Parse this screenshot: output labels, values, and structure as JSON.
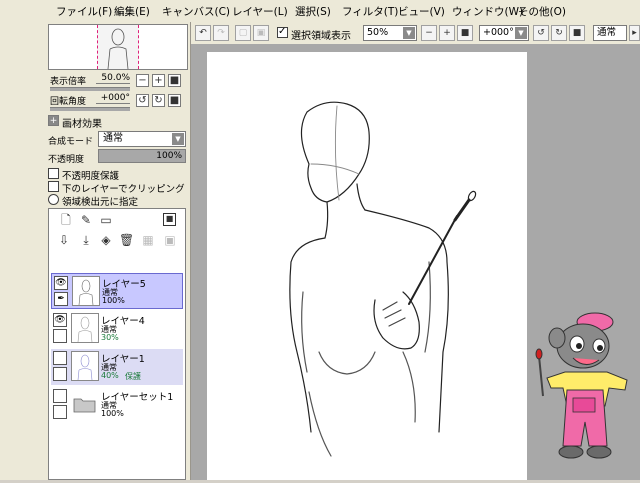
{
  "menu": [
    "ファイル(F)",
    "編集(E)",
    "キャンバス(C)",
    "レイヤー(L)",
    "選択(S)",
    "フィルタ(T)",
    "ビュー(V)",
    "ウィンドウ(W)",
    "その他(O)"
  ],
  "navigator": {
    "zoom_label": "表示倍率",
    "zoom_value": "50.0%",
    "rotate_label": "回転角度",
    "rotate_value": "+000°"
  },
  "paper_effect": {
    "header": "画材効果",
    "blend_label": "合成モード",
    "blend_value": "通常",
    "opacity_label": "不透明度",
    "opacity_value": "100%",
    "opts": [
      "不透明度保護",
      "下のレイヤーでクリッピング",
      "領域検出元に指定"
    ]
  },
  "layers": [
    {
      "name": "レイヤー5",
      "mode": "通常",
      "opacity": "100%",
      "extra": "",
      "visible": true,
      "selected": true
    },
    {
      "name": "レイヤー4",
      "mode": "通常",
      "opacity": "30%",
      "extra": "",
      "visible": true,
      "selected": false
    },
    {
      "name": "レイヤー1",
      "mode": "通常",
      "opacity": "40%",
      "extra": "保護",
      "visible": false,
      "selected": false
    },
    {
      "name": "レイヤーセット1",
      "mode": "通常",
      "opacity": "100%",
      "extra": "",
      "visible": false,
      "selected": false
    }
  ],
  "toolbar": {
    "selection_checkbox_label": "選択領域表示",
    "zoom_value": "50%",
    "angle_value": "+000°",
    "mode_value": "通常"
  },
  "colors": {
    "selected_layer": "#c8c8ff",
    "canvas_bg": "#a8a8a8",
    "nav_frame": "#e0207a"
  }
}
